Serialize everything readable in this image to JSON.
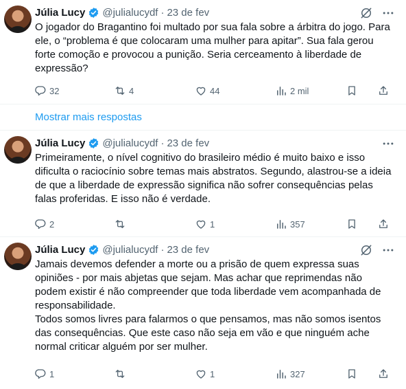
{
  "show_more": "Mostrar mais respostas",
  "tweets": [
    {
      "name": "Júlia Lucy",
      "handle": "@julialucydf",
      "dot": "·",
      "date": "23 de fev",
      "paragraphs": [
        "O jogador do Bragantino foi multado por sua fala sobre a árbitra do jogo. Para ele, o “problema é que colocaram uma mulher para apitar”. Sua fala gerou forte comoção e provocou a punição. Seria cerceamento à liberdade de expressão?"
      ],
      "replies": "32",
      "reposts": "4",
      "likes": "44",
      "views": "2 mil"
    },
    {
      "name": "Júlia Lucy",
      "handle": "@julialucydf",
      "dot": "·",
      "date": "23 de fev",
      "paragraphs": [
        "Primeiramente, o nível cognitivo do brasileiro médio é muito baixo e isso dificulta o raciocínio sobre temas mais abstratos. Segundo, alastrou-se a ideia de que a liberdade de expressão significa não sofrer consequências pelas falas proferidas. E isso não é verdade."
      ],
      "replies": "2",
      "reposts": "",
      "likes": "1",
      "views": "357"
    },
    {
      "name": "Júlia Lucy",
      "handle": "@julialucydf",
      "dot": "·",
      "date": "23 de fev",
      "paragraphs": [
        "Jamais devemos defender a morte ou a prisão de quem expressa suas opiniões - por mais abjetas que sejam. Mas achar que reprimendas não podem existir é não compreender que toda liberdade vem acompanhada de responsabilidade.",
        "Todos somos livres para falarmos o que pensamos, mas não somos isentos das consequências. Que este caso não seja em vão e que ninguém ache normal criticar alguém por ser mulher."
      ],
      "replies": "1",
      "reposts": "",
      "likes": "1",
      "views": "327"
    }
  ],
  "colors": {
    "accent": "#1d9bf0",
    "muted": "#536471",
    "text": "#0f1419",
    "border": "#eff3f4"
  },
  "icons": [
    "verified-badge-icon",
    "grok-icon",
    "more-icon",
    "reply-icon",
    "repost-icon",
    "like-icon",
    "views-icon",
    "bookmark-icon",
    "share-icon"
  ]
}
